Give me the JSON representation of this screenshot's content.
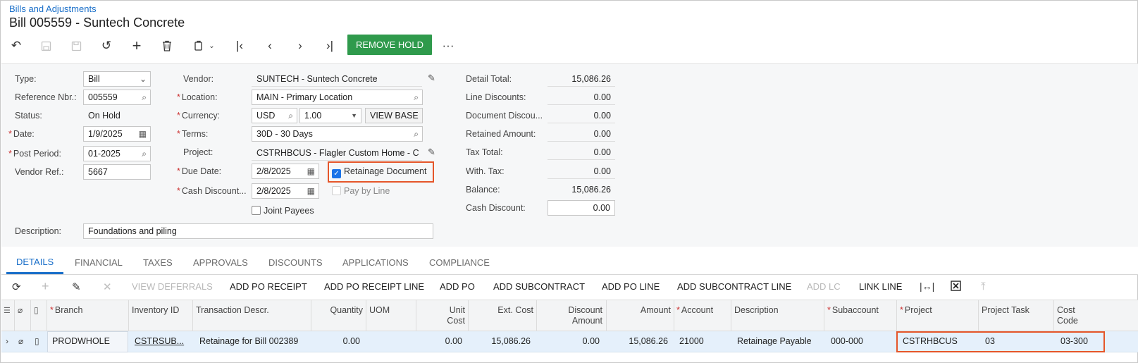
{
  "breadcrumb": "Bills and Adjustments",
  "page_title": "Bill 005559 - Suntech Concrete",
  "toolbar": {
    "remove_hold": "REMOVE HOLD",
    "more": "···"
  },
  "form": {
    "type_label": "Type:",
    "type_value": "Bill",
    "refnbr_label": "Reference Nbr.:",
    "refnbr_value": "005559",
    "status_label": "Status:",
    "status_value": "On Hold",
    "date_label": "Date:",
    "date_value": "1/9/2025",
    "postperiod_label": "Post Period:",
    "postperiod_value": "01-2025",
    "vendorref_label": "Vendor Ref.:",
    "vendorref_value": "5667",
    "vendor_label": "Vendor:",
    "vendor_value": "SUNTECH - Suntech Concrete",
    "location_label": "Location:",
    "location_value": "MAIN - Primary Location",
    "currency_label": "Currency:",
    "currency_value": "USD",
    "rate_value": "1.00",
    "view_base": "VIEW BASE",
    "terms_label": "Terms:",
    "terms_value": "30D - 30 Days",
    "project_label": "Project:",
    "project_value": "CSTRHBCUS - Flagler Custom Home - C",
    "duedate_label": "Due Date:",
    "duedate_value": "2/8/2025",
    "cashdisc_label": "Cash Discount...",
    "cashdisc_value": "2/8/2025",
    "retainage_label": "Retainage Document",
    "paybyline_label": "Pay by Line",
    "jointpayees_label": "Joint Payees",
    "description_label": "Description:",
    "description_value": "Foundations and piling"
  },
  "totals": {
    "detail_total_label": "Detail Total:",
    "detail_total": "15,086.26",
    "line_discounts_label": "Line Discounts:",
    "line_discounts": "0.00",
    "document_discount_label": "Document Discou...",
    "document_discount": "0.00",
    "retained_amount_label": "Retained Amount:",
    "retained_amount": "0.00",
    "tax_total_label": "Tax Total:",
    "tax_total": "0.00",
    "with_tax_label": "With. Tax:",
    "with_tax": "0.00",
    "balance_label": "Balance:",
    "balance": "15,086.26",
    "cash_discount_label": "Cash Discount:",
    "cash_discount": "0.00"
  },
  "tabs": [
    "DETAILS",
    "FINANCIAL",
    "TAXES",
    "APPROVALS",
    "DISCOUNTS",
    "APPLICATIONS",
    "COMPLIANCE"
  ],
  "grid_toolbar": {
    "view_deferrals": "VIEW DEFERRALS",
    "add_po_receipt": "ADD PO RECEIPT",
    "add_po_receipt_line": "ADD PO RECEIPT LINE",
    "add_po": "ADD PO",
    "add_subcontract": "ADD SUBCONTRACT",
    "add_po_line": "ADD PO LINE",
    "add_subcontract_line": "ADD SUBCONTRACT LINE",
    "add_lc": "ADD LC",
    "link_line": "LINK LINE"
  },
  "grid": {
    "headers": {
      "branch": "Branch",
      "inventory_id": "Inventory ID",
      "transaction_descr": "Transaction Descr.",
      "quantity": "Quantity",
      "uom": "UOM",
      "unit_cost_1": "Unit",
      "unit_cost_2": "Cost",
      "ext_cost": "Ext. Cost",
      "discount_amount_1": "Discount",
      "discount_amount_2": "Amount",
      "amount": "Amount",
      "account": "Account",
      "description": "Description",
      "subaccount": "Subaccount",
      "project": "Project",
      "project_task": "Project Task",
      "cost_code_1": "Cost",
      "cost_code_2": "Code"
    },
    "row": {
      "branch": "PRODWHOLE",
      "inventory_id": "CSTRSUB...",
      "transaction_descr": "Retainage for Bill 002389",
      "quantity": "0.00",
      "uom": "",
      "unit_cost": "0.00",
      "ext_cost": "15,086.26",
      "discount_amount": "0.00",
      "amount": "15,086.26",
      "account": "21000",
      "description": "Retainage Payable",
      "subaccount": "000-000",
      "project": "CSTRHBCUS",
      "project_task": "03",
      "cost_code": "03-300"
    }
  },
  "colors": {
    "accent": "#1a6fc9",
    "hold_button": "#2f9a4c",
    "highlight": "#e5562a",
    "row_selected": "#e5f0fb"
  }
}
